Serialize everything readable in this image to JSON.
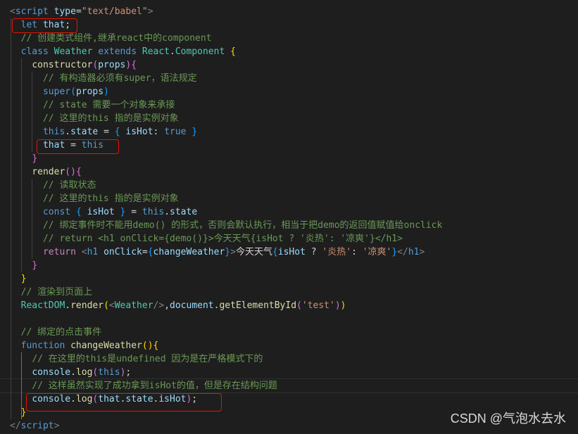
{
  "lines": [
    [
      [
        "t-tag",
        "<"
      ],
      [
        "t-tagname",
        "script"
      ],
      [
        "t-txt",
        " "
      ],
      [
        "t-attr",
        "type"
      ],
      [
        "t-txt",
        "="
      ],
      [
        "t-str",
        "\"text/babel\""
      ],
      [
        "t-tag",
        ">"
      ]
    ],
    [
      [
        "t-txt",
        "  "
      ],
      [
        "t-kw",
        "let"
      ],
      [
        "t-txt",
        " "
      ],
      [
        "t-var",
        "that"
      ],
      [
        "t-txt",
        ";"
      ]
    ],
    [
      [
        "t-txt",
        "  "
      ],
      [
        "t-cmt",
        "// 创建类式组件,继承react中的component"
      ]
    ],
    [
      [
        "t-txt",
        "  "
      ],
      [
        "t-kw",
        "class"
      ],
      [
        "t-txt",
        " "
      ],
      [
        "t-type",
        "Weather"
      ],
      [
        "t-txt",
        " "
      ],
      [
        "t-kw",
        "extends"
      ],
      [
        "t-txt",
        " "
      ],
      [
        "t-type",
        "React"
      ],
      [
        "t-txt",
        "."
      ],
      [
        "t-type",
        "Component"
      ],
      [
        "t-txt",
        " "
      ],
      [
        "t-p1",
        "{"
      ]
    ],
    [
      [
        "t-txt",
        "    "
      ],
      [
        "t-fn",
        "constructor"
      ],
      [
        "t-p2",
        "("
      ],
      [
        "t-var",
        "props"
      ],
      [
        "t-p2",
        ")"
      ],
      [
        "t-p2",
        "{"
      ]
    ],
    [
      [
        "t-txt",
        "      "
      ],
      [
        "t-cmt",
        "// 有构造器必须有super，语法规定"
      ]
    ],
    [
      [
        "t-txt",
        "      "
      ],
      [
        "t-kw",
        "super"
      ],
      [
        "t-p3",
        "("
      ],
      [
        "t-var",
        "props"
      ],
      [
        "t-p3",
        ")"
      ]
    ],
    [
      [
        "t-txt",
        "      "
      ],
      [
        "t-cmt",
        "// state 需要一个对象来承接"
      ]
    ],
    [
      [
        "t-txt",
        "      "
      ],
      [
        "t-cmt",
        "// 这里的this 指的是实例对象"
      ]
    ],
    [
      [
        "t-txt",
        "      "
      ],
      [
        "t-kw",
        "this"
      ],
      [
        "t-txt",
        "."
      ],
      [
        "t-var",
        "state"
      ],
      [
        "t-txt",
        " = "
      ],
      [
        "t-p3",
        "{"
      ],
      [
        "t-txt",
        " "
      ],
      [
        "t-var",
        "isHot"
      ],
      [
        "t-txt",
        ": "
      ],
      [
        "t-kw",
        "true"
      ],
      [
        "t-txt",
        " "
      ],
      [
        "t-p3",
        "}"
      ]
    ],
    [
      [
        "t-txt",
        "      "
      ],
      [
        "t-var",
        "that"
      ],
      [
        "t-txt",
        " = "
      ],
      [
        "t-kw",
        "this"
      ]
    ],
    [
      [
        "t-txt",
        "    "
      ],
      [
        "t-p2",
        "}"
      ]
    ],
    [
      [
        "t-txt",
        "    "
      ],
      [
        "t-fn",
        "render"
      ],
      [
        "t-p2",
        "("
      ],
      [
        "t-p2",
        ")"
      ],
      [
        "t-p2",
        "{"
      ]
    ],
    [
      [
        "t-txt",
        "      "
      ],
      [
        "t-cmt",
        "// 读取状态"
      ]
    ],
    [
      [
        "t-txt",
        "      "
      ],
      [
        "t-cmt",
        "// 这里的this 指的是实例对象"
      ]
    ],
    [
      [
        "t-txt",
        "      "
      ],
      [
        "t-kw",
        "const"
      ],
      [
        "t-txt",
        " "
      ],
      [
        "t-p3",
        "{"
      ],
      [
        "t-txt",
        " "
      ],
      [
        "t-var",
        "isHot"
      ],
      [
        "t-txt",
        " "
      ],
      [
        "t-p3",
        "}"
      ],
      [
        "t-txt",
        " = "
      ],
      [
        "t-kw",
        "this"
      ],
      [
        "t-txt",
        "."
      ],
      [
        "t-var",
        "state"
      ]
    ],
    [
      [
        "t-txt",
        "      "
      ],
      [
        "t-cmt",
        "// 绑定事件时不能用demo() 的形式，否则会默认执行，相当于把demo的返回值赋值给onclick"
      ]
    ],
    [
      [
        "t-txt",
        "      "
      ],
      [
        "t-cmt",
        "// return <h1 onClick={demo()}>今天天气{isHot ? '炎热': '凉爽'}</h1>"
      ]
    ],
    [
      [
        "t-txt",
        "      "
      ],
      [
        "t-ctrl",
        "return"
      ],
      [
        "t-txt",
        " "
      ],
      [
        "t-tag",
        "<"
      ],
      [
        "t-jsx",
        "h1"
      ],
      [
        "t-txt",
        " "
      ],
      [
        "t-attr",
        "onClick"
      ],
      [
        "t-txt",
        "="
      ],
      [
        "t-p3",
        "{"
      ],
      [
        "t-var",
        "changeWeather"
      ],
      [
        "t-p3",
        "}"
      ],
      [
        "t-tag",
        ">"
      ],
      [
        "t-txt",
        "今天天气"
      ],
      [
        "t-p3",
        "{"
      ],
      [
        "t-var",
        "isHot"
      ],
      [
        "t-txt",
        " ? "
      ],
      [
        "t-str",
        "'炎热'"
      ],
      [
        "t-txt",
        ": "
      ],
      [
        "t-str",
        "'凉爽'"
      ],
      [
        "t-p3",
        "}"
      ],
      [
        "t-tag",
        "</"
      ],
      [
        "t-jsx",
        "h1"
      ],
      [
        "t-tag",
        ">"
      ]
    ],
    [
      [
        "t-txt",
        "    "
      ],
      [
        "t-p2",
        "}"
      ]
    ],
    [
      [
        "t-txt",
        "  "
      ],
      [
        "t-p1",
        "}"
      ]
    ],
    [
      [
        "t-txt",
        "  "
      ],
      [
        "t-cmt",
        "// 渲染到页面上"
      ]
    ],
    [
      [
        "t-txt",
        "  "
      ],
      [
        "t-type",
        "ReactDOM"
      ],
      [
        "t-txt",
        "."
      ],
      [
        "t-fn",
        "render"
      ],
      [
        "t-p1",
        "("
      ],
      [
        "t-tag",
        "<"
      ],
      [
        "t-type",
        "Weather"
      ],
      [
        "t-tag",
        "/>"
      ],
      [
        "t-txt",
        ","
      ],
      [
        "t-var",
        "document"
      ],
      [
        "t-txt",
        "."
      ],
      [
        "t-fn",
        "getElementById"
      ],
      [
        "t-p2",
        "("
      ],
      [
        "t-str",
        "'test'"
      ],
      [
        "t-p2",
        ")"
      ],
      [
        "t-p1",
        ")"
      ]
    ],
    [],
    [
      [
        "t-txt",
        "  "
      ],
      [
        "t-cmt",
        "// 绑定的点击事件"
      ]
    ],
    [
      [
        "t-txt",
        "  "
      ],
      [
        "t-kw",
        "function"
      ],
      [
        "t-txt",
        " "
      ],
      [
        "t-fn",
        "changeWeather"
      ],
      [
        "t-p1",
        "("
      ],
      [
        "t-p1",
        ")"
      ],
      [
        "t-p1",
        "{"
      ]
    ],
    [
      [
        "t-txt",
        "    "
      ],
      [
        "t-cmt",
        "// 在这里的this是undefined 因为是在严格模式下的"
      ]
    ],
    [
      [
        "t-txt",
        "    "
      ],
      [
        "t-var",
        "console"
      ],
      [
        "t-txt",
        "."
      ],
      [
        "t-fn",
        "log"
      ],
      [
        "t-p2",
        "("
      ],
      [
        "t-kw",
        "this"
      ],
      [
        "t-p2",
        ")"
      ],
      [
        "t-txt",
        ";"
      ]
    ],
    [
      [
        "t-txt",
        "    "
      ],
      [
        "t-cmt",
        "// 这样虽然实现了成功拿到isHot的值，但是存在结构问题"
      ]
    ],
    [
      [
        "t-txt",
        "    "
      ],
      [
        "t-var",
        "console"
      ],
      [
        "t-txt",
        "."
      ],
      [
        "t-fn",
        "log"
      ],
      [
        "t-p2",
        "("
      ],
      [
        "t-var",
        "that"
      ],
      [
        "t-txt",
        "."
      ],
      [
        "t-var",
        "state"
      ],
      [
        "t-txt",
        "."
      ],
      [
        "t-var",
        "isHot"
      ],
      [
        "t-p2",
        ")"
      ],
      [
        "t-txt",
        ";"
      ]
    ],
    [
      [
        "t-txt",
        "  "
      ],
      [
        "t-p1",
        "}"
      ]
    ],
    [
      [
        "t-tag",
        "</"
      ],
      [
        "t-tagname",
        "script"
      ],
      [
        "t-tag",
        ">"
      ]
    ]
  ],
  "watermark": "CSDN @气泡水去水"
}
